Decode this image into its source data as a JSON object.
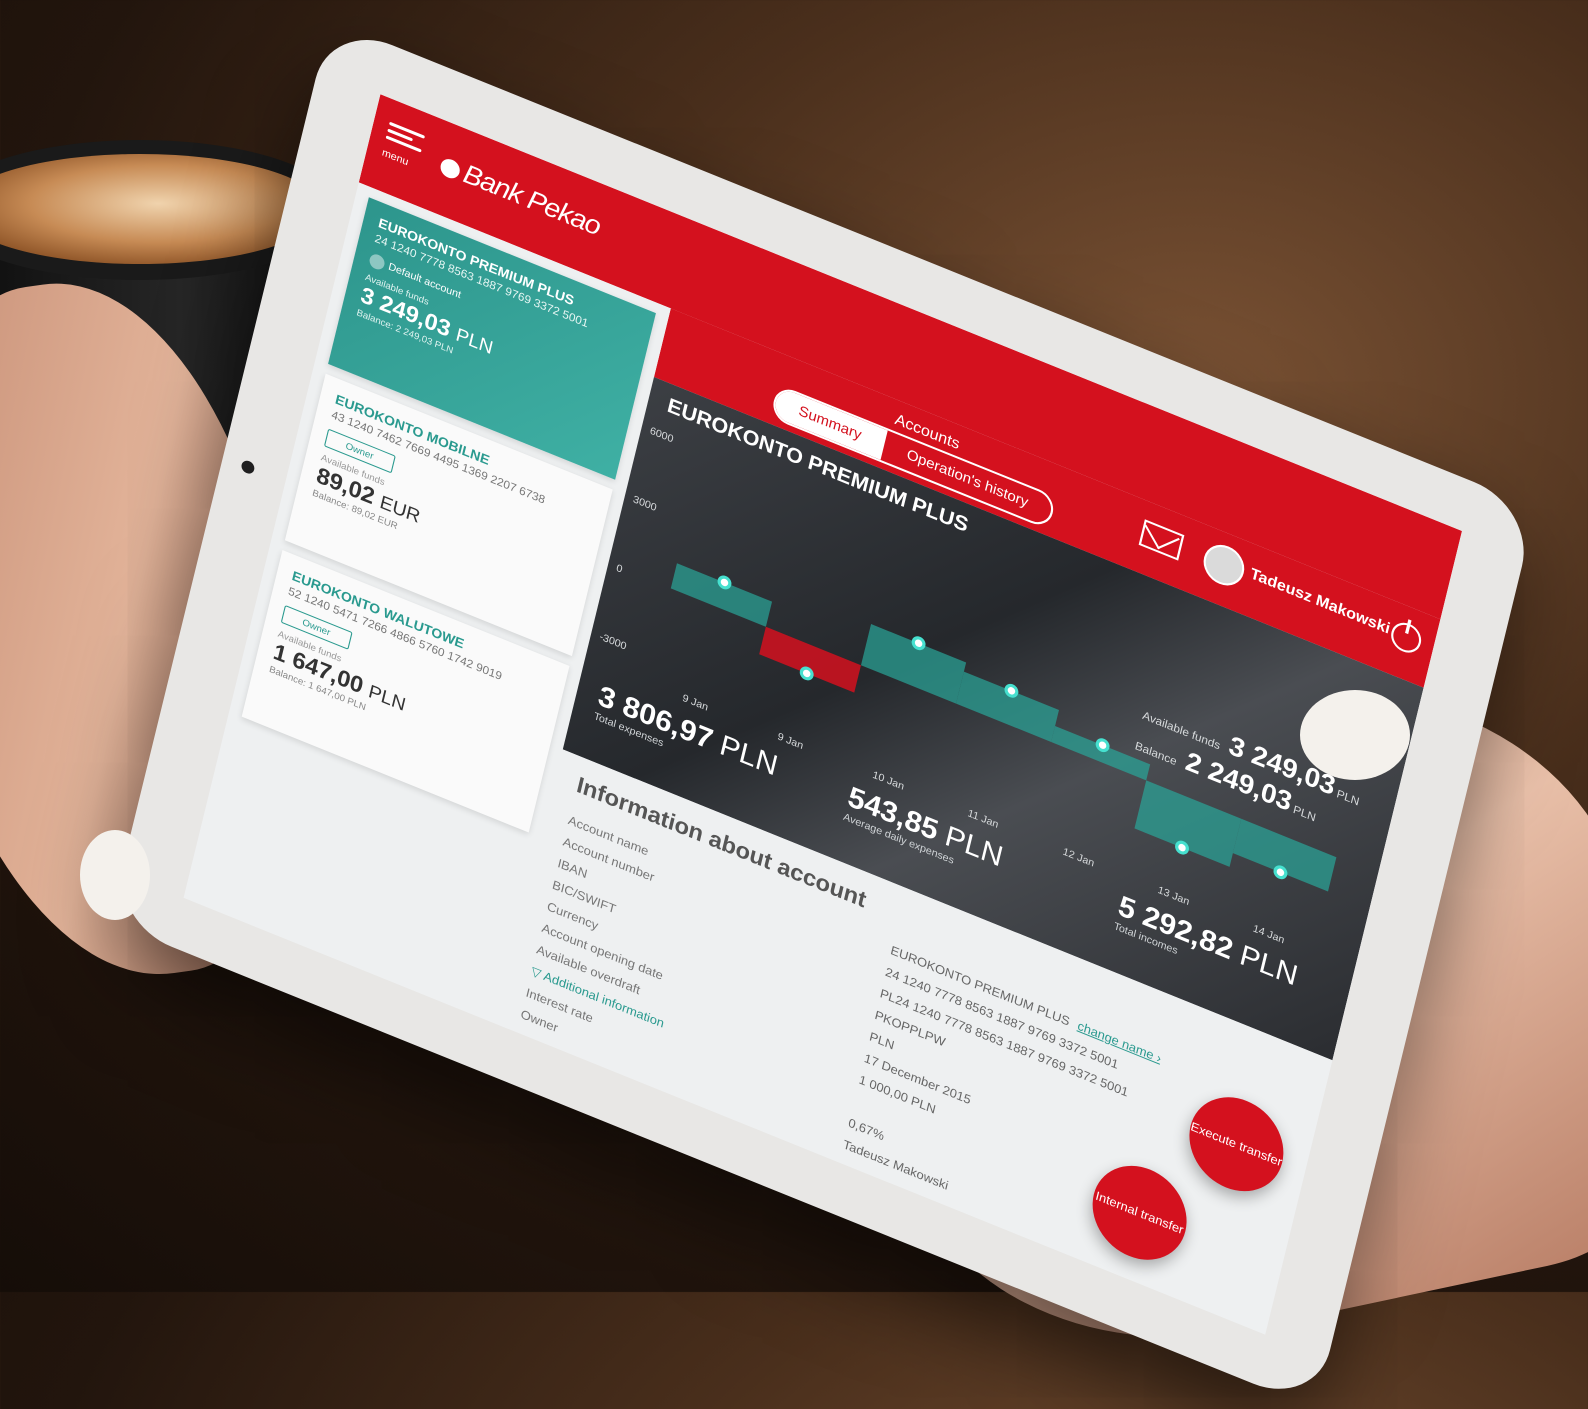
{
  "app": {
    "brand": "Bank Pekao",
    "menu_label": "menu"
  },
  "header": {
    "title": "Accounts",
    "tabs": [
      {
        "label": "Summary",
        "active": true
      },
      {
        "label": "Operation's history",
        "active": false
      }
    ],
    "user_name": "Tadeusz Makowski",
    "icons": [
      "menu-icon",
      "mail-icon",
      "avatar",
      "power-icon"
    ]
  },
  "accounts": [
    {
      "name": "EUROKONTO PREMIUM PLUS",
      "number": "24 1240 7778 8563 1887 9769 3372 5001",
      "default_label": "Default account",
      "available_label": "Available funds",
      "available_amount": "3 249,03",
      "available_currency": "PLN",
      "balance": "Balance: 2 249,03 PLN",
      "active": true
    },
    {
      "name": "EUROKONTO MOBILNE",
      "number": "43 1240 7462 7669 4495 1369 2207 6738",
      "role": "Owner",
      "available_label": "Available funds",
      "available_amount": "89,02",
      "available_currency": "EUR",
      "balance": "Balance: 89,02 EUR",
      "active": false
    },
    {
      "name": "EUROKONTO WALUTOWE",
      "number": "52 1240 5471 7266 4866 5760 1742 9019",
      "role": "Owner",
      "available_label": "Available funds",
      "available_amount": "1 647,00",
      "available_currency": "PLN",
      "balance": "Balance: 1 647,00 PLN",
      "active": false
    }
  ],
  "summary": {
    "account_title": "EUROKONTO PREMIUM PLUS",
    "available_label": "Available funds",
    "available_value": "3 249,03",
    "available_currency": "PLN",
    "balance_label": "Balance",
    "balance_value": "2 249,03",
    "balance_currency": "PLN",
    "total_expenses": "3 806,97",
    "total_expenses_currency": "PLN",
    "total_expenses_label": "Total expenses",
    "avg_daily": "543,85",
    "avg_daily_currency": "PLN",
    "avg_daily_label": "Average daily expenses",
    "total_incomes": "5 292,82",
    "total_incomes_currency": "PLN",
    "total_incomes_label": "Total incomes"
  },
  "chart_data": {
    "type": "area",
    "title": "",
    "y_ticks": [
      "6000",
      "3000",
      "0",
      "-3000"
    ],
    "ylim": [
      -3000,
      6000
    ],
    "x": [
      "9 Jan",
      "9 Jan",
      "10 Jan",
      "11 Jan",
      "12 Jan",
      "13 Jan",
      "14 Jan"
    ],
    "series": [
      {
        "values": [
          1100,
          -1200,
          1800,
          1400,
          700,
          -2100,
          -1500
        ]
      }
    ],
    "negative_color": "#d4111e",
    "positive_color": "#2aa79a",
    "grid": false
  },
  "info": {
    "title": "Information about account",
    "rows": [
      {
        "label": "Account name",
        "value": "EUROKONTO PREMIUM PLUS",
        "link": "change name ›"
      },
      {
        "label": "Account number",
        "value": "24 1240 7778 8563 1887 9769 3372 5001"
      },
      {
        "label": "IBAN",
        "value": "PL24 1240 7778 8563 1887 9769 3372 5001"
      },
      {
        "label": "BIC/SWIFT",
        "value": "PKOPPLPW"
      },
      {
        "label": "Currency",
        "value": "PLN"
      },
      {
        "label": "Account opening date",
        "value": "17 December 2015"
      },
      {
        "label": "Available overdraft",
        "value": "1 000,00 PLN"
      },
      {
        "label": "Interest rate",
        "value": "0,67%"
      },
      {
        "label": "Owner",
        "value": "Tadeusz Makowski"
      }
    ],
    "additional_label": "▽ Additional information"
  },
  "actions": {
    "execute_transfer": "Execute transfer",
    "internal_transfer": "Internal transfer"
  }
}
